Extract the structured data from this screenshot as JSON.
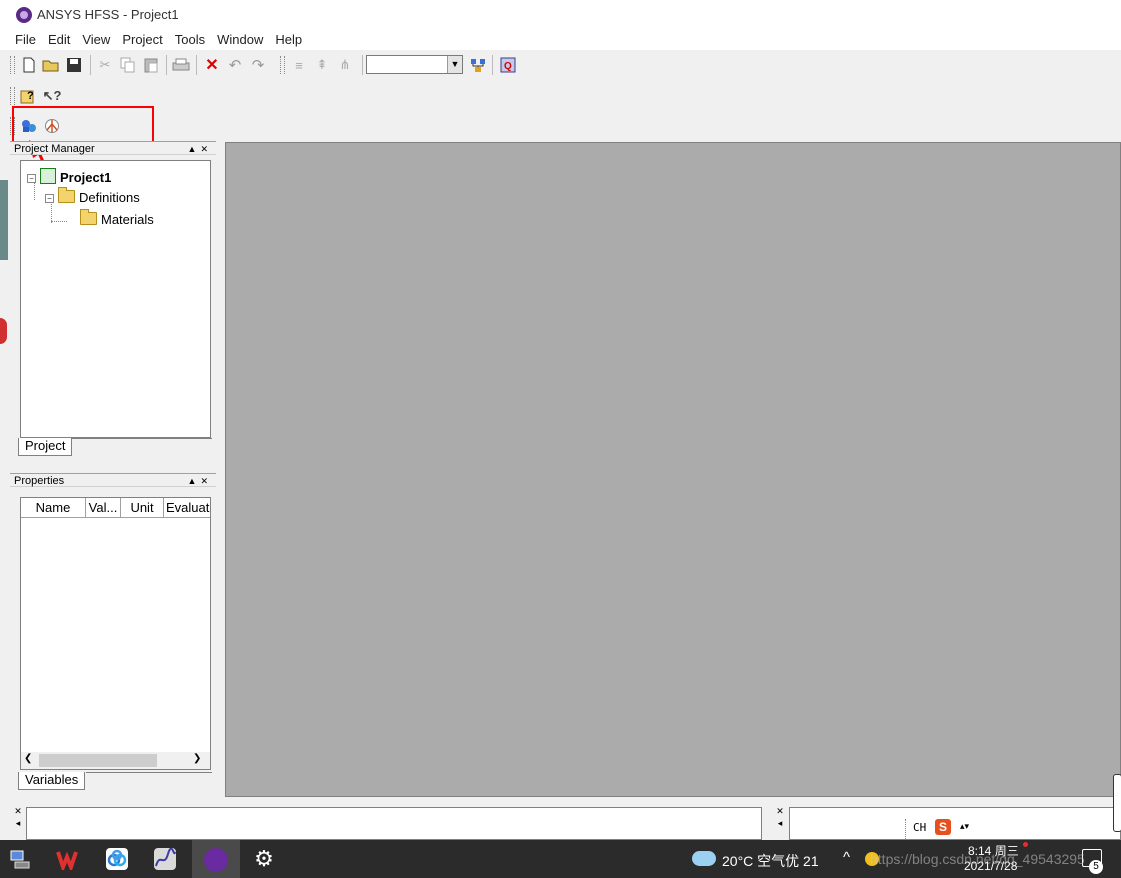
{
  "window": {
    "title": "ANSYS HFSS - Project1"
  },
  "menu": [
    "File",
    "Edit",
    "View",
    "Project",
    "Tools",
    "Window",
    "Help"
  ],
  "toolbar": {
    "icons": [
      "new-file-icon",
      "open-folder-icon",
      "save-icon",
      "cut-icon",
      "copy-icon",
      "paste-icon",
      "print-icon",
      "delete-icon",
      "undo-icon",
      "redo-icon",
      "align-icon",
      "up-icon",
      "tree-icon",
      "combo-box",
      "network-icon",
      "quick-icon"
    ],
    "combo_value": ""
  },
  "project_manager": {
    "title": "Project Manager",
    "tree": {
      "project": "Project1",
      "definitions": "Definitions",
      "materials": "Materials"
    },
    "tab_label": "Project"
  },
  "properties": {
    "title": "Properties",
    "columns": [
      "Name",
      "Val...",
      "Unit",
      "Evaluat"
    ],
    "tab_label": "Variables"
  },
  "taskbar": {
    "weather": "20°C 空气优 21",
    "ime": "CH",
    "clock_time": "8:14 周三",
    "clock_date": "2021/7/28",
    "notification_count": "5",
    "watermark": "https://blog.csdn.net/qq_49543295"
  },
  "colors": {
    "highlight": "#ff0000",
    "arrow": "#ff0000",
    "workspace": "#ababab"
  }
}
